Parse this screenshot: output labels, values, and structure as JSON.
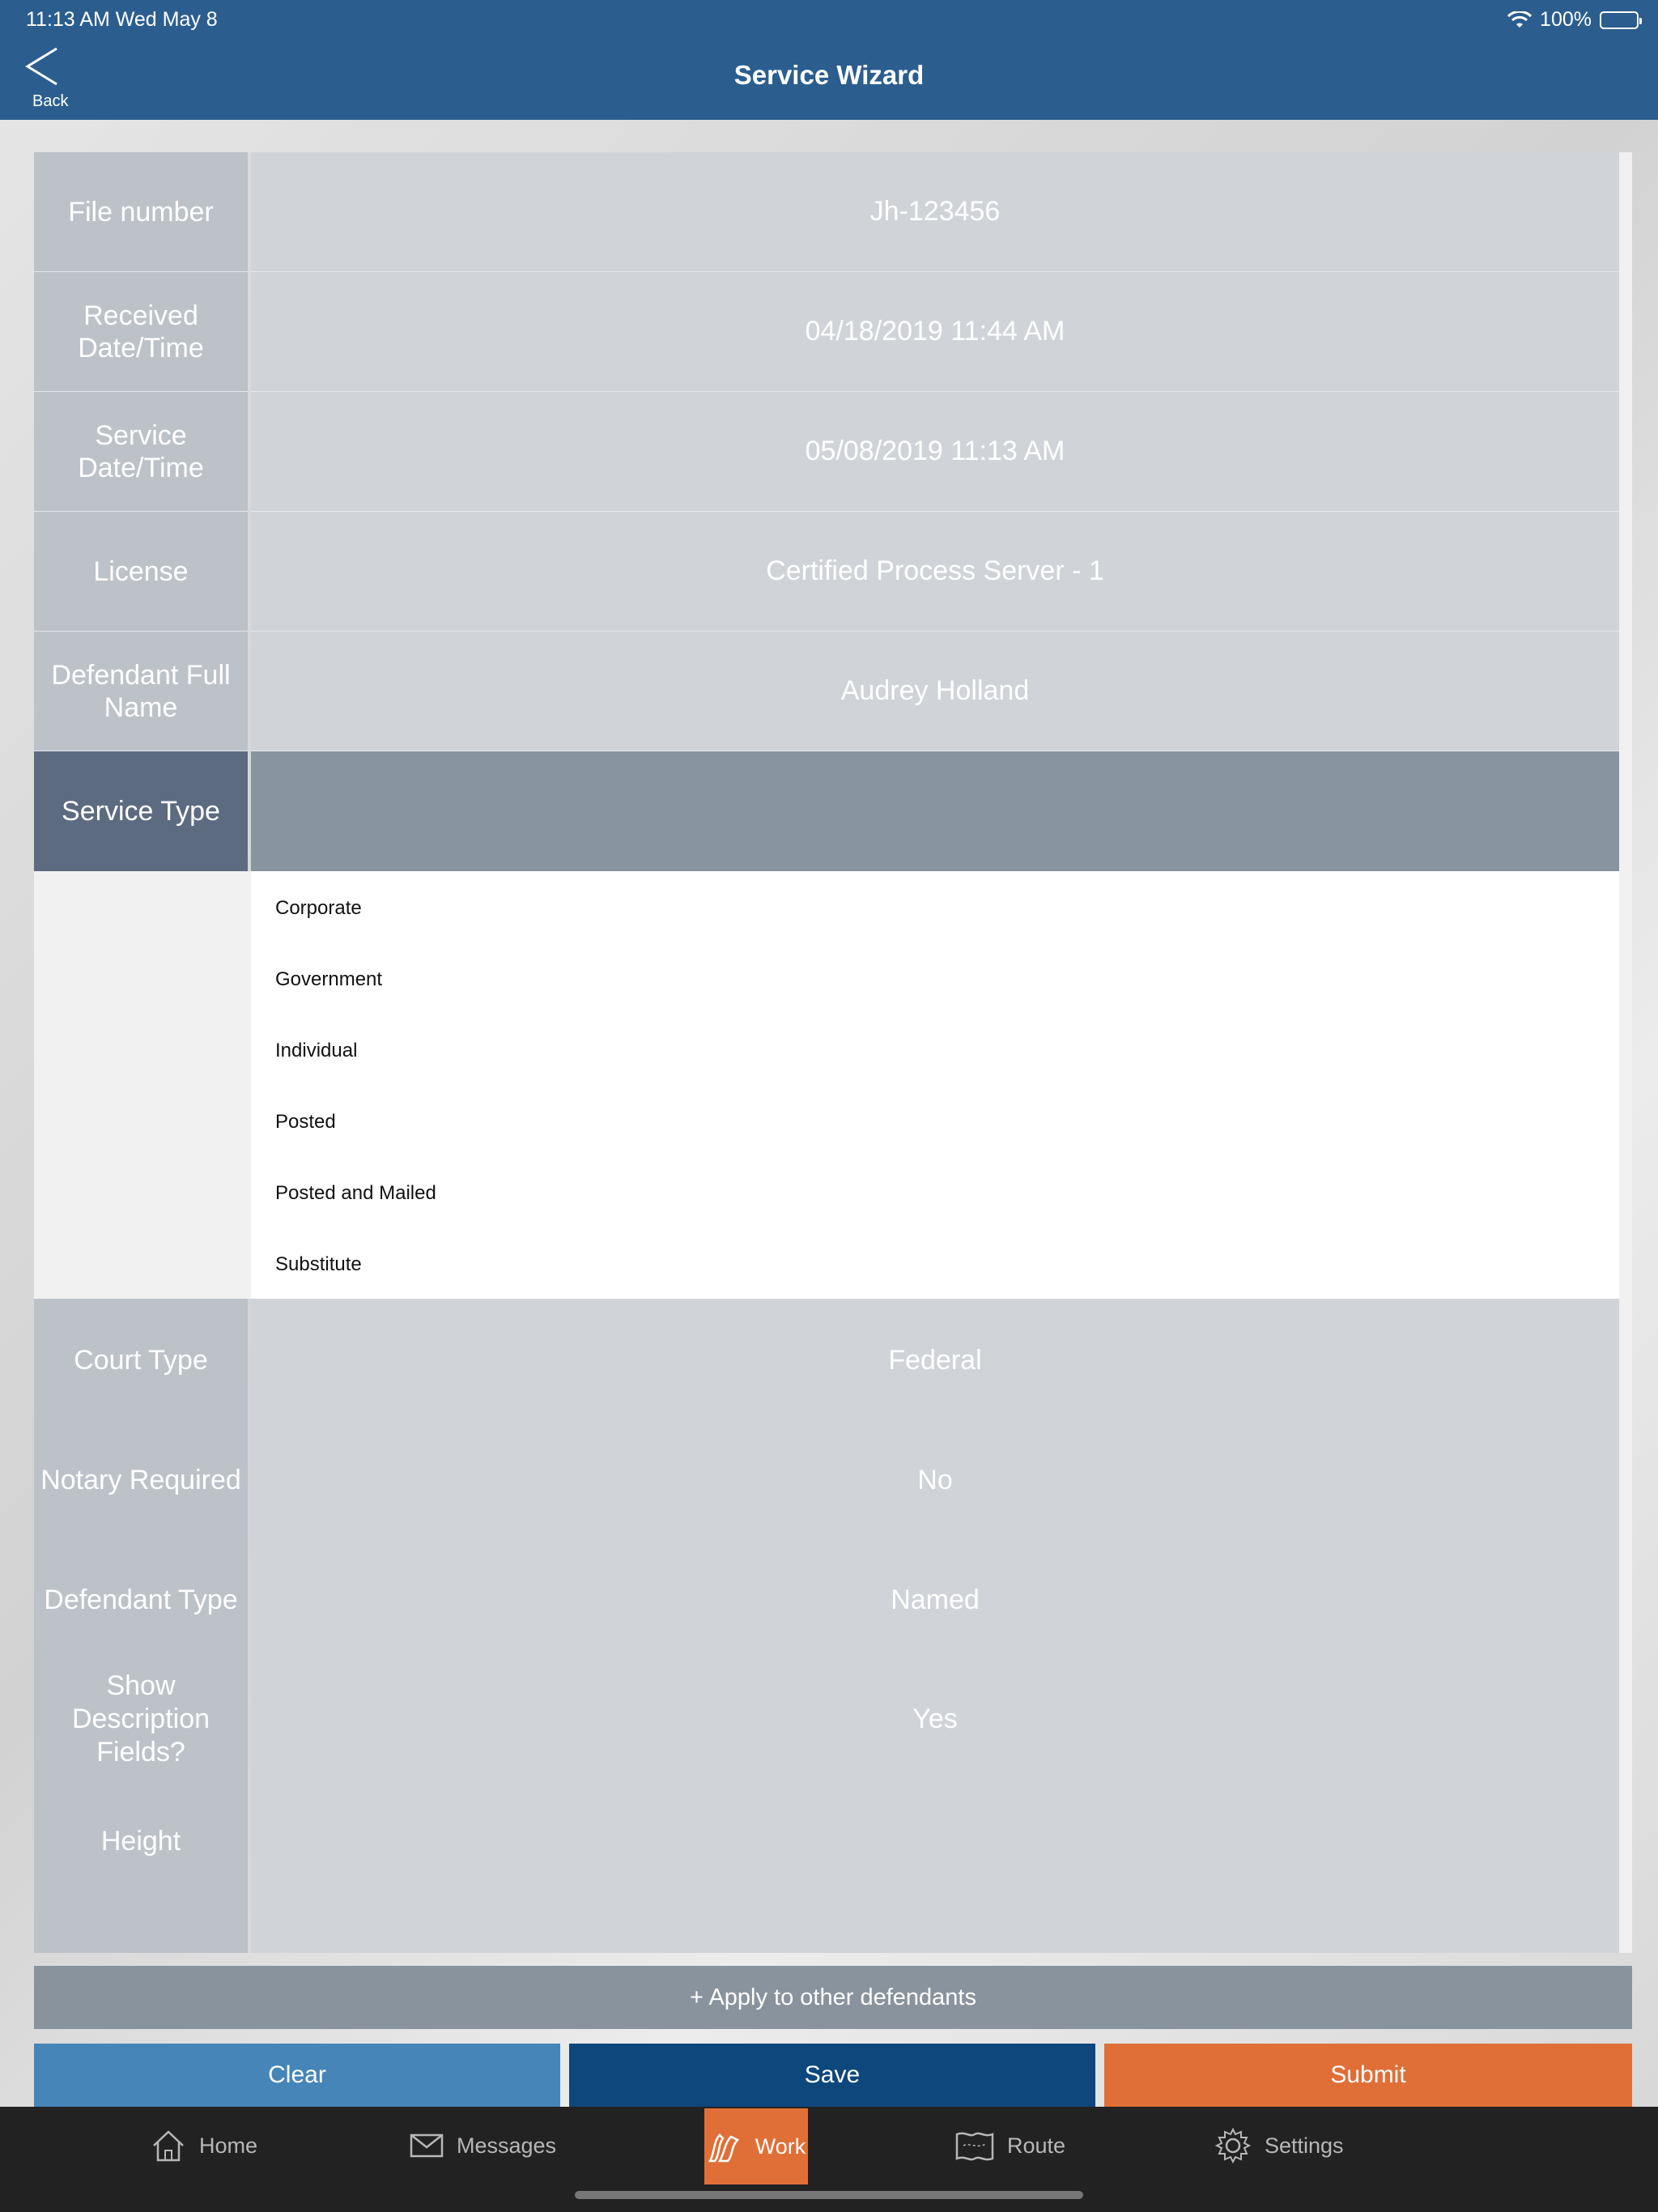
{
  "status_bar": {
    "time": "11:13 AM   Wed May 8",
    "battery": "100%"
  },
  "nav": {
    "back_label": "Back",
    "title": "Service Wizard"
  },
  "form_rows": [
    {
      "label": "File number",
      "value": "Jh-123456"
    },
    {
      "label": "Received Date/Time",
      "value": "04/18/2019 11:44 AM"
    },
    {
      "label": "Service Date/Time",
      "value": "05/08/2019 11:13 AM"
    },
    {
      "label": "License",
      "value": "Certified Process Server - 1"
    },
    {
      "label": "Defendant Full Name",
      "value": "Audrey Holland"
    },
    {
      "label": "Service Type",
      "value": ""
    }
  ],
  "service_type_options": [
    "Corporate",
    "Government",
    "Individual",
    "Posted",
    "Posted and Mailed",
    "Substitute"
  ],
  "lower_rows": [
    {
      "label": "Court Type",
      "value": "Federal"
    },
    {
      "label": "Notary Required",
      "value": "No"
    },
    {
      "label": "Defendant Type",
      "value": "Named"
    },
    {
      "label": "Show Description Fields?",
      "value": "Yes"
    },
    {
      "label": "Height",
      "value": ""
    }
  ],
  "actions": {
    "apply_label": "+ Apply to other defendants",
    "clear_label": "Clear",
    "save_label": "Save",
    "submit_label": "Submit"
  },
  "tabs": [
    {
      "label": "Home",
      "icon": "home-icon"
    },
    {
      "label": "Messages",
      "icon": "envelope-icon"
    },
    {
      "label": "Work",
      "icon": "work-icon",
      "active": true
    },
    {
      "label": "Route",
      "icon": "map-icon"
    },
    {
      "label": "Settings",
      "icon": "gear-icon"
    }
  ],
  "colors": {
    "nav_bar": "#2b5e8e",
    "active_tab": "#e06f37",
    "clear_button": "#4585b8",
    "save_button": "#0d477c",
    "submit_button": "#e06f37"
  }
}
